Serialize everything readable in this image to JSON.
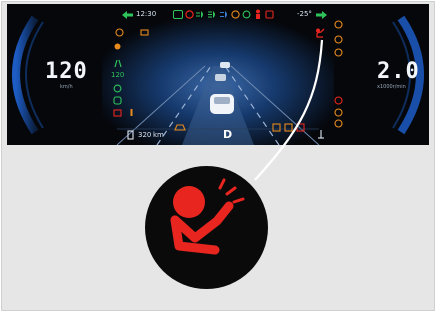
{
  "cluster": {
    "top_bar": {
      "time": "12:30",
      "temperature": "-25°"
    },
    "speed": {
      "value": "120",
      "unit": "km/h"
    },
    "rpm": {
      "value": "2.0",
      "unit": "x1000r/min"
    },
    "left_panel": {
      "range_label": "120"
    },
    "bottom": {
      "range": "320",
      "range_unit": "km",
      "gear": "D"
    },
    "colors": {
      "warning_red": "#e8261f",
      "amber": "#e88a1c",
      "indicator_green": "#2fc45a",
      "info_blue": "#3a7bd5",
      "gauge_blue": "#2a6fd6"
    }
  },
  "callout": {
    "icon": "airbag-warning-icon",
    "color": "#e8261f"
  }
}
